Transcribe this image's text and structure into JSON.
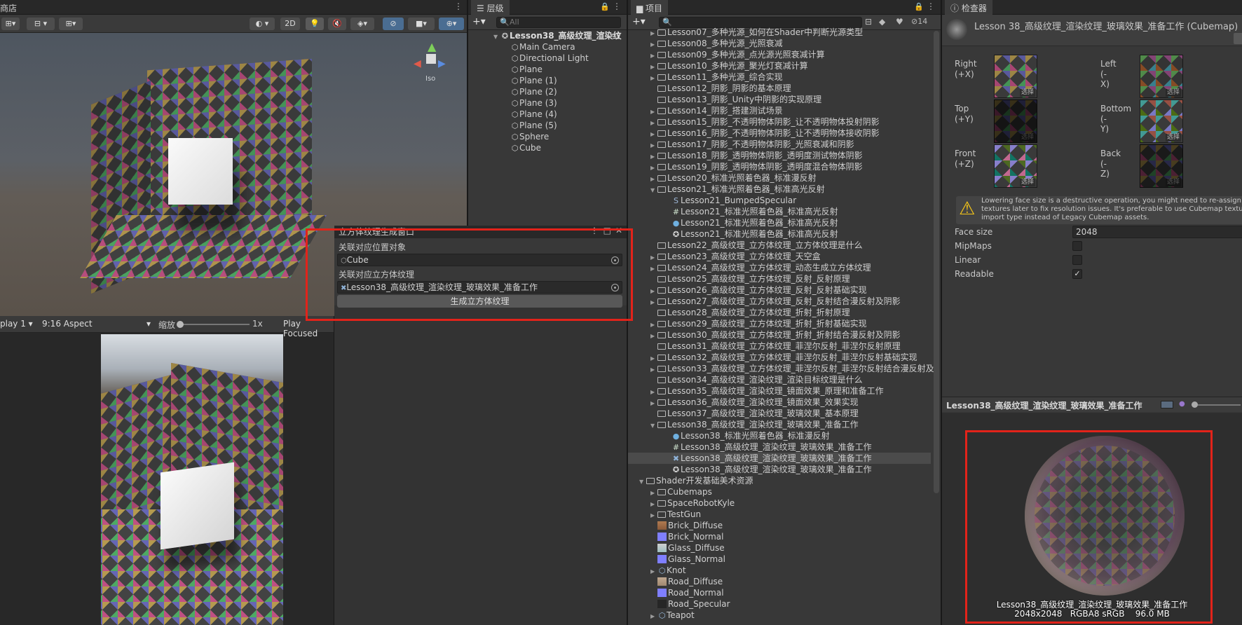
{
  "scene": {
    "tab": "商店",
    "toolbar": {
      "mode_2d": "2D"
    },
    "gizmo": {
      "persp": "Iso"
    }
  },
  "game": {
    "display": "play 1",
    "aspect": "9:16 Aspect",
    "scale_label": "缩放",
    "scale_value": "1x",
    "play_mode": "Play Focused"
  },
  "hierarchy": {
    "tab": "层级",
    "add": "+",
    "search_placeholder": "All",
    "root": "Lesson38_高级纹理_渲染纹",
    "items": [
      "Main Camera",
      "Directional Light",
      "Plane",
      "Plane (1)",
      "Plane (2)",
      "Plane (3)",
      "Plane (4)",
      "Plane (5)",
      "Sphere",
      "Cube"
    ]
  },
  "cube_window": {
    "title": "立方体纹理生成窗口",
    "label_object": "关联对应位置对象",
    "object_value": "Cube",
    "label_cubemap": "关联对应立方体纹理",
    "cubemap_value": "Lesson38_高级纹理_渲染纹理_玻璃效果_准备工作",
    "generate_button": "生成立方体纹理"
  },
  "project": {
    "tab": "项目",
    "add": "+",
    "hidden_count": "14",
    "items": [
      {
        "name": "Lesson07_多种光源_如何在Shader中判断光源类型",
        "kind": "folder",
        "depth": 1,
        "open": false
      },
      {
        "name": "Lesson08_多种光源_光照衰减",
        "kind": "folder",
        "depth": 1,
        "open": false
      },
      {
        "name": "Lesson09_多种光源_点光源光照衰减计算",
        "kind": "folder",
        "depth": 1,
        "open": false
      },
      {
        "name": "Lesson10_多种光源_聚光灯衰减计算",
        "kind": "folder",
        "depth": 1,
        "open": false
      },
      {
        "name": "Lesson11_多种光源_综合实现",
        "kind": "folder",
        "depth": 1,
        "open": false
      },
      {
        "name": "Lesson12_阴影_阴影的基本原理",
        "kind": "folder",
        "depth": 1,
        "open": null
      },
      {
        "name": "Lesson13_阴影_Unity中阴影的实现原理",
        "kind": "folder",
        "depth": 1,
        "open": null
      },
      {
        "name": "Lesson14_阴影_搭建测试场景",
        "kind": "folder",
        "depth": 1,
        "open": false
      },
      {
        "name": "Lesson15_阴影_不透明物体阴影_让不透明物体投射阴影",
        "kind": "folder",
        "depth": 1,
        "open": false
      },
      {
        "name": "Lesson16_阴影_不透明物体阴影_让不透明物体接收阴影",
        "kind": "folder",
        "depth": 1,
        "open": false
      },
      {
        "name": "Lesson17_阴影_不透明物体阴影_光照衰减和阴影",
        "kind": "folder",
        "depth": 1,
        "open": false
      },
      {
        "name": "Lesson18_阴影_透明物体阴影_透明度测试物体阴影",
        "kind": "folder",
        "depth": 1,
        "open": false
      },
      {
        "name": "Lesson19_阴影_透明物体阴影_透明度混合物体阴影",
        "kind": "folder",
        "depth": 1,
        "open": false
      },
      {
        "name": "Lesson20_标准光照着色器_标准漫反射",
        "kind": "folder",
        "depth": 1,
        "open": false
      },
      {
        "name": "Lesson21_标准光照着色器_标准高光反射",
        "kind": "folder",
        "depth": 1,
        "open": true
      },
      {
        "name": "Lesson21_BumpedSpecular",
        "kind": "shader",
        "depth": 2
      },
      {
        "name": "Lesson21_标准光照着色器_标准高光反射",
        "kind": "script",
        "depth": 2
      },
      {
        "name": "Lesson21_标准光照着色器_标准高光反射",
        "kind": "material",
        "depth": 2
      },
      {
        "name": "Lesson21_标准光照着色器_标准高光反射",
        "kind": "scene",
        "depth": 2
      },
      {
        "name": "Lesson22_高级纹理_立方体纹理_立方体纹理是什么",
        "kind": "folder",
        "depth": 1,
        "open": null
      },
      {
        "name": "Lesson23_高级纹理_立方体纹理_天空盒",
        "kind": "folder",
        "depth": 1,
        "open": false
      },
      {
        "name": "Lesson24_高级纹理_立方体纹理_动态生成立方体纹理",
        "kind": "folder",
        "depth": 1,
        "open": false
      },
      {
        "name": "Lesson25_高级纹理_立方体纹理_反射_反射原理",
        "kind": "folder",
        "depth": 1,
        "open": null
      },
      {
        "name": "Lesson26_高级纹理_立方体纹理_反射_反射基础实现",
        "kind": "folder",
        "depth": 1,
        "open": false
      },
      {
        "name": "Lesson27_高级纹理_立方体纹理_反射_反射结合漫反射及阴影",
        "kind": "folder",
        "depth": 1,
        "open": false
      },
      {
        "name": "Lesson28_高级纹理_立方体纹理_折射_折射原理",
        "kind": "folder",
        "depth": 1,
        "open": null
      },
      {
        "name": "Lesson29_高级纹理_立方体纹理_折射_折射基础实现",
        "kind": "folder",
        "depth": 1,
        "open": false
      },
      {
        "name": "Lesson30_高级纹理_立方体纹理_折射_折射结合漫反射及阴影",
        "kind": "folder",
        "depth": 1,
        "open": false
      },
      {
        "name": "Lesson31_高级纹理_立方体纹理_菲涅尔反射_菲涅尔反射原理",
        "kind": "folder",
        "depth": 1,
        "open": null
      },
      {
        "name": "Lesson32_高级纹理_立方体纹理_菲涅尔反射_菲涅尔反射基础实现",
        "kind": "folder",
        "depth": 1,
        "open": false
      },
      {
        "name": "Lesson33_高级纹理_立方体纹理_菲涅尔反射_菲涅尔反射结合漫反射及",
        "kind": "folder",
        "depth": 1,
        "open": false
      },
      {
        "name": "Lesson34_高级纹理_渲染纹理_渲染目标纹理是什么",
        "kind": "folder",
        "depth": 1,
        "open": null
      },
      {
        "name": "Lesson35_高级纹理_渲染纹理_镜面效果_原理和准备工作",
        "kind": "folder",
        "depth": 1,
        "open": false
      },
      {
        "name": "Lesson36_高级纹理_渲染纹理_镜面效果_效果实现",
        "kind": "folder",
        "depth": 1,
        "open": false
      },
      {
        "name": "Lesson37_高级纹理_渲染纹理_玻璃效果_基本原理",
        "kind": "folder",
        "depth": 1,
        "open": null
      },
      {
        "name": "Lesson38_高级纹理_渲染纹理_玻璃效果_准备工作",
        "kind": "folder",
        "depth": 1,
        "open": true
      },
      {
        "name": "Lesson38_标准光照着色器_标准漫反射",
        "kind": "material",
        "depth": 2
      },
      {
        "name": "Lesson38_高级纹理_渲染纹理_玻璃效果_准备工作",
        "kind": "script",
        "depth": 2
      },
      {
        "name": "Lesson38_高级纹理_渲染纹理_玻璃效果_准备工作",
        "kind": "cubemap",
        "depth": 2,
        "selected": true
      },
      {
        "name": "Lesson38_高级纹理_渲染纹理_玻璃效果_准备工作",
        "kind": "scene",
        "depth": 2
      },
      {
        "name": "Shader开发基础美术资源",
        "kind": "folder",
        "depth": 0,
        "open": true
      },
      {
        "name": "Cubemaps",
        "kind": "folder",
        "depth": 1,
        "open": false
      },
      {
        "name": "SpaceRobotKyle",
        "kind": "folder",
        "depth": 1,
        "open": false
      },
      {
        "name": "TestGun",
        "kind": "folder",
        "depth": 1,
        "open": false
      },
      {
        "name": "Brick_Diffuse",
        "kind": "tex-brick",
        "depth": 1
      },
      {
        "name": "Brick_Normal",
        "kind": "tex-normal",
        "depth": 1
      },
      {
        "name": "Glass_Diffuse",
        "kind": "tex-glass",
        "depth": 1
      },
      {
        "name": "Glass_Normal",
        "kind": "tex-normal",
        "depth": 1
      },
      {
        "name": "Knot",
        "kind": "model",
        "depth": 1,
        "open": false
      },
      {
        "name": "Road_Diffuse",
        "kind": "tex-road",
        "depth": 1
      },
      {
        "name": "Road_Normal",
        "kind": "tex-normal",
        "depth": 1
      },
      {
        "name": "Road_Specular",
        "kind": "tex-dark",
        "depth": 1
      },
      {
        "name": "Teapot",
        "kind": "model",
        "depth": 1,
        "open": false
      }
    ]
  },
  "inspector": {
    "tab": "检查器",
    "title": "Lesson 38_高级纹理_渲染纹理_玻璃效果_准备工作 (Cubemap)",
    "faces": [
      {
        "name": "Right",
        "axis": "(+X)"
      },
      {
        "name": "Left",
        "axis": "(-X)"
      },
      {
        "name": "Top",
        "axis": "(+Y)"
      },
      {
        "name": "Bottom",
        "axis": "(-Y)"
      },
      {
        "name": "Front",
        "axis": "(+Z)"
      },
      {
        "name": "Back",
        "axis": "(-Z)"
      }
    ],
    "select_label": "选择",
    "warning_l1": "Lowering face size is a destructive operation, you might need to re-assign the",
    "warning_l2": "textures later to fix resolution issues. It's preferable to use Cubemap texture",
    "warning_l3": "import type instead of Legacy Cubemap assets.",
    "face_size_label": "Face size",
    "face_size_value": "2048",
    "mipmaps_label": "MipMaps",
    "linear_label": "Linear",
    "readable_label": "Readable",
    "mipmaps": false,
    "linear": false,
    "readable": true,
    "preview_title": "Lesson38_高级纹理_渲染纹理_玻璃效果_准备工作",
    "preview_caption": "Lesson38_高级纹理_渲染纹理_玻璃效果_准备工作",
    "preview_info": "2048x2048   RGBA8 sRGB    96.0 MB"
  },
  "colors": {
    "highlight": "#e2231a",
    "selected_row": "#4b4b4b"
  }
}
